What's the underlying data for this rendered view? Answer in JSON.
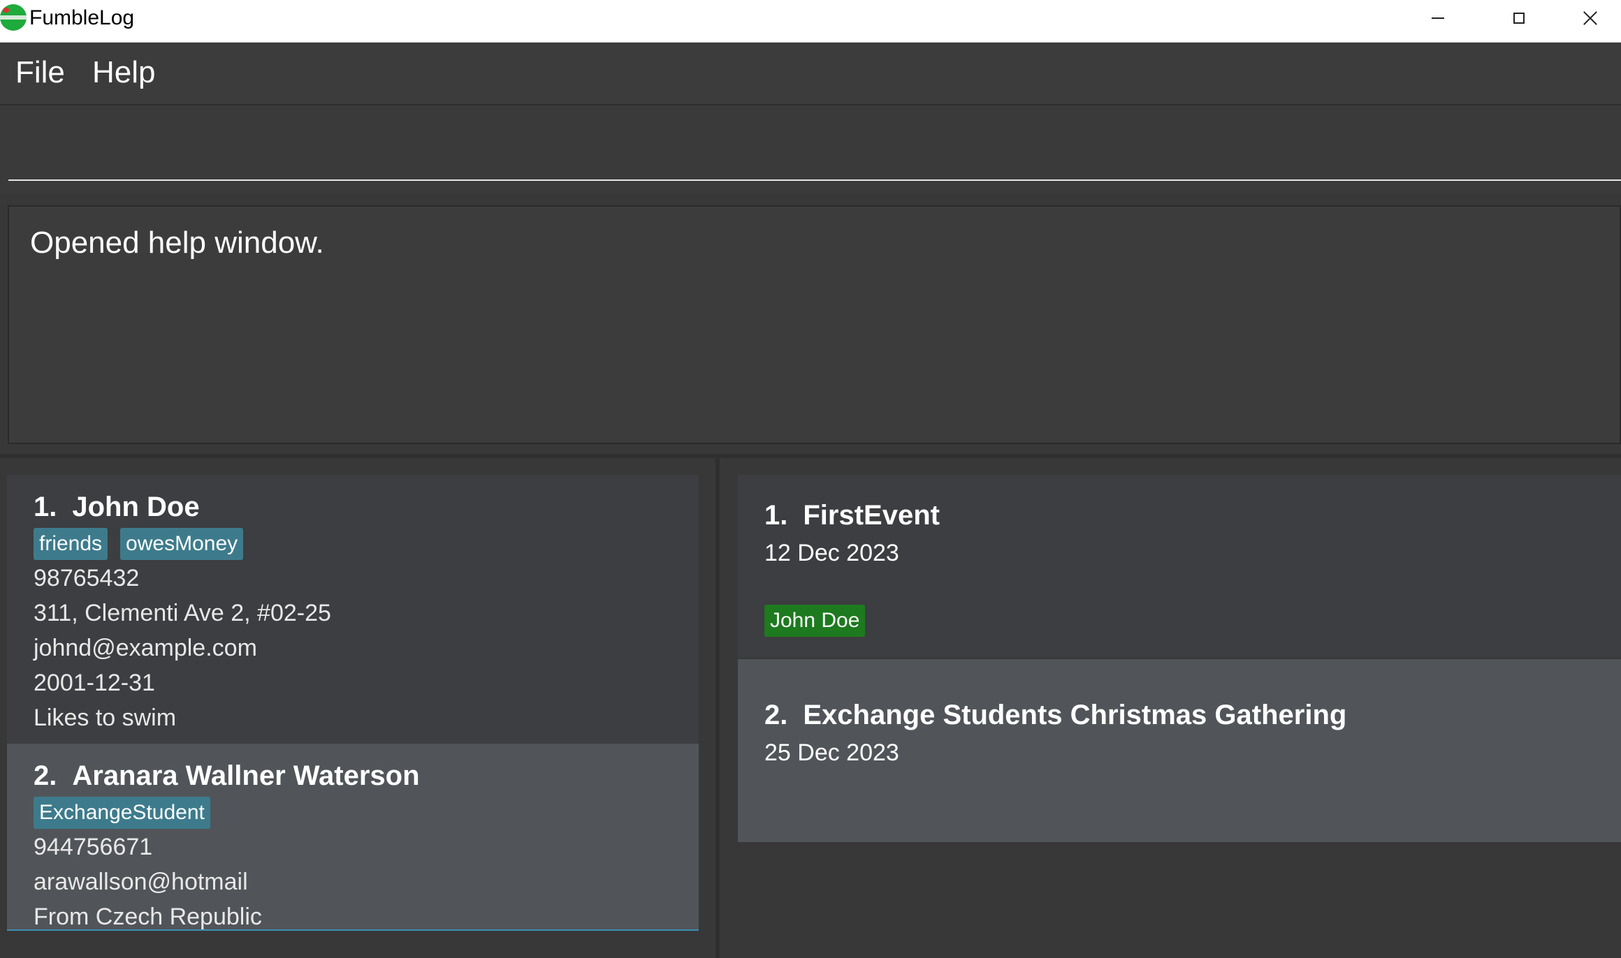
{
  "window": {
    "title": "FumbleLog"
  },
  "menu": {
    "file": "File",
    "help": "Help"
  },
  "command_box": {
    "value": ""
  },
  "result_display": {
    "text": "Opened help window."
  },
  "persons": [
    {
      "index": "1.",
      "name": "John Doe",
      "tags": [
        "friends",
        "owesMoney"
      ],
      "phone": "98765432",
      "address": "311, Clementi Ave 2, #02-25",
      "email": "johnd@example.com",
      "birthday": "2001-12-31",
      "remark": "Likes to swim"
    },
    {
      "index": "2.",
      "name": "Aranara Wallner Waterson",
      "tags": [
        "ExchangeStudent"
      ],
      "phone": "944756671",
      "email": "arawallson@hotmail",
      "remark": "From Czech Republic"
    }
  ],
  "events": [
    {
      "index": "1.",
      "name": "FirstEvent",
      "date": "12 Dec 2023",
      "persons": [
        "John Doe"
      ]
    },
    {
      "index": "2.",
      "name": "Exchange Students Christmas Gathering",
      "date": "25 Dec 2023",
      "persons": []
    }
  ],
  "colors": {
    "background": "#383838",
    "tag_blue": "#3d7b8c",
    "tag_green": "#1d7a1f",
    "selected_border": "#3a8fb5"
  }
}
